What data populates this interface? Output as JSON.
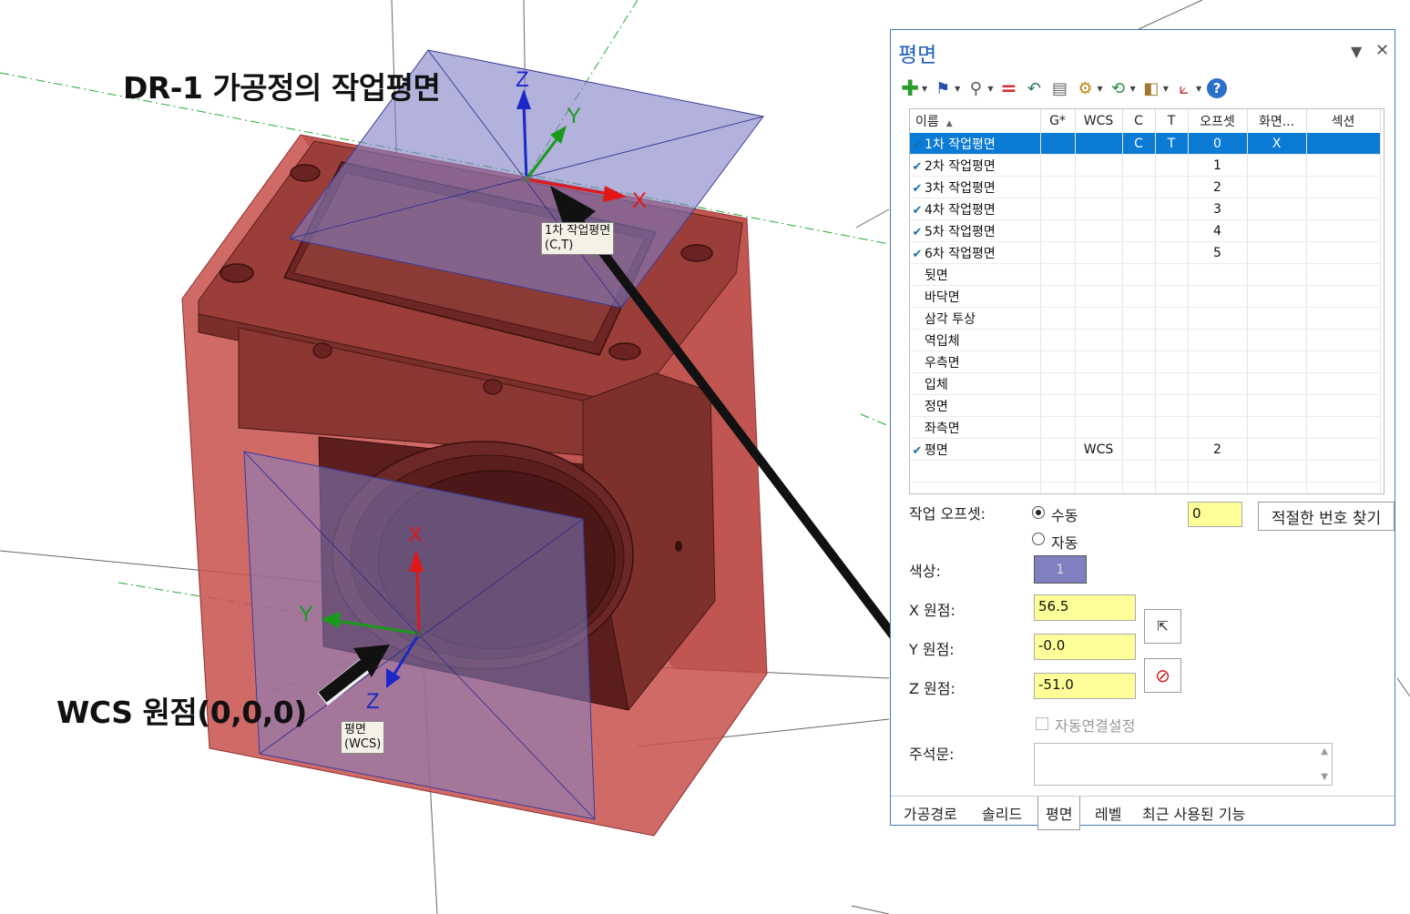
{
  "annotations": {
    "title": "DR-1 가공정의 작업평면",
    "wcs_origin": "WCS 원점(0,0,0)",
    "plane_label_top": "1차 작업평면\n(C,T)",
    "plane_label_bottom": "평면\n(WCS)"
  },
  "axes": {
    "top": {
      "x": "X",
      "y": "Y",
      "z": "Z"
    },
    "bottom": {
      "x": "X",
      "y": "Y",
      "z": "Z"
    }
  },
  "colors": {
    "solid": "#c8504c",
    "plane": "#7f7fc4",
    "panel_accent": "#1f5fb4",
    "selection": "#0c7bd6",
    "field_bg": "#ffff99"
  },
  "panel": {
    "title": "평면",
    "pin_icon": "pin-dropdown-icon",
    "close_icon": "close-icon",
    "toolbar": [
      "add-icon",
      "flag-icon",
      "search-icon",
      "equal-icon",
      "undo-icon",
      "calculator-icon",
      "gear-icon",
      "refresh-icon",
      "box-icon",
      "axes-icon",
      "help-icon"
    ],
    "columns": [
      "이름",
      "G*",
      "WCS",
      "C",
      "T",
      "오프셋",
      "화면...",
      "섹션"
    ],
    "rows": [
      {
        "checked": true,
        "name": "1차 작업평면",
        "g": "",
        "wcs": "",
        "c": "C",
        "t": "T",
        "offset": "0",
        "display": "X",
        "section": ""
      },
      {
        "checked": true,
        "name": "2차 작업평면",
        "g": "",
        "wcs": "",
        "c": "",
        "t": "",
        "offset": "1",
        "display": "",
        "section": ""
      },
      {
        "checked": true,
        "name": "3차 작업평면",
        "g": "",
        "wcs": "",
        "c": "",
        "t": "",
        "offset": "2",
        "display": "",
        "section": ""
      },
      {
        "checked": true,
        "name": "4차 작업평면",
        "g": "",
        "wcs": "",
        "c": "",
        "t": "",
        "offset": "3",
        "display": "",
        "section": ""
      },
      {
        "checked": true,
        "name": "5차 작업평면",
        "g": "",
        "wcs": "",
        "c": "",
        "t": "",
        "offset": "4",
        "display": "",
        "section": ""
      },
      {
        "checked": true,
        "name": "6차 작업평면",
        "g": "",
        "wcs": "",
        "c": "",
        "t": "",
        "offset": "5",
        "display": "",
        "section": ""
      },
      {
        "checked": false,
        "name": "뒷면",
        "g": "",
        "wcs": "",
        "c": "",
        "t": "",
        "offset": "",
        "display": "",
        "section": ""
      },
      {
        "checked": false,
        "name": "바닥면",
        "g": "",
        "wcs": "",
        "c": "",
        "t": "",
        "offset": "",
        "display": "",
        "section": ""
      },
      {
        "checked": false,
        "name": "삼각 투상",
        "g": "",
        "wcs": "",
        "c": "",
        "t": "",
        "offset": "",
        "display": "",
        "section": ""
      },
      {
        "checked": false,
        "name": "역입체",
        "g": "",
        "wcs": "",
        "c": "",
        "t": "",
        "offset": "",
        "display": "",
        "section": ""
      },
      {
        "checked": false,
        "name": "우측면",
        "g": "",
        "wcs": "",
        "c": "",
        "t": "",
        "offset": "",
        "display": "",
        "section": ""
      },
      {
        "checked": false,
        "name": "입체",
        "g": "",
        "wcs": "",
        "c": "",
        "t": "",
        "offset": "",
        "display": "",
        "section": ""
      },
      {
        "checked": false,
        "name": "정면",
        "g": "",
        "wcs": "",
        "c": "",
        "t": "",
        "offset": "",
        "display": "",
        "section": ""
      },
      {
        "checked": false,
        "name": "좌측면",
        "g": "",
        "wcs": "",
        "c": "",
        "t": "",
        "offset": "",
        "display": "",
        "section": ""
      },
      {
        "checked": true,
        "name": "평면",
        "g": "",
        "wcs": "WCS",
        "c": "",
        "t": "",
        "offset": "2",
        "display": "",
        "section": ""
      }
    ],
    "selected_row": 0,
    "work_offset_label": "작업 오프셋:",
    "manual_label": "수동",
    "auto_label": "자동",
    "offset_value": "0",
    "find_button": "적절한 번호 찾기",
    "color_label": "색상:",
    "color_value": "1",
    "x_label": "X 원점:",
    "x_value": "56.5",
    "y_label": "Y 원점:",
    "y_value": "-0.0",
    "z_label": "Z 원점:",
    "z_value": "-51.0",
    "pick_icon": "cursor-select-icon",
    "clear_icon": "no-entry-icon",
    "auto_link_label": "자동연결설정",
    "comment_label": "주석문:",
    "tabs": [
      "가공경로",
      "솔리드",
      "평면",
      "레벨",
      "최근 사용된 기능"
    ],
    "active_tab": 2
  }
}
